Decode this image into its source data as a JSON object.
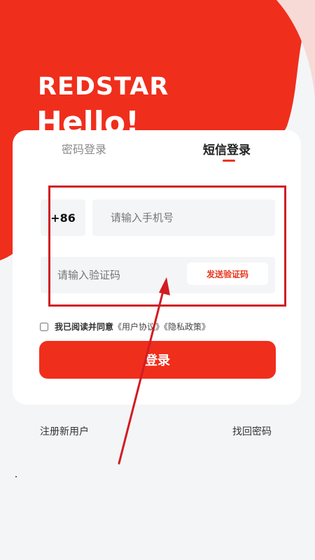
{
  "brand": {
    "logo_text": "REDSTAR",
    "greeting": "Hello!"
  },
  "tabs": [
    {
      "label": "密码登录",
      "active": false
    },
    {
      "label": "短信登录",
      "active": true
    }
  ],
  "form": {
    "country_code": "+86",
    "phone_placeholder": "请输入手机号",
    "code_placeholder": "请输入验证码",
    "send_code_label": "发送验证码",
    "agree_prefix": "我已阅读并同意",
    "user_agreement": "《用户协议》",
    "privacy_policy": "《隐私政策》",
    "login_label": "登录"
  },
  "footer": {
    "register_label": "注册新用户",
    "forgot_label": "找回密码"
  },
  "colors": {
    "accent": "#f02e1c",
    "annotation": "#d11c22"
  }
}
